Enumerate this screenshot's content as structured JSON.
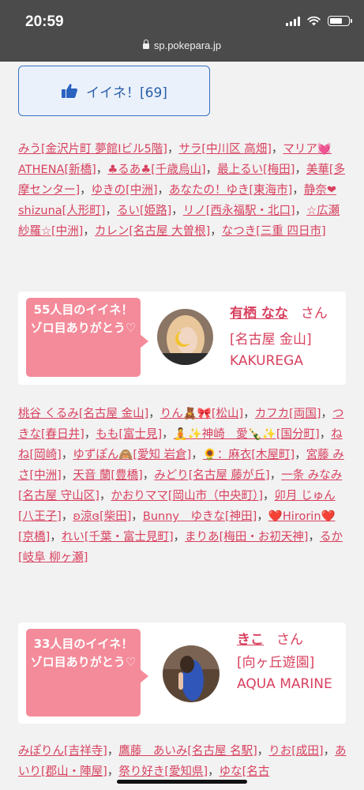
{
  "status_bar": {
    "time": "20:59"
  },
  "browser": {
    "url": "sp.pokepara.jp"
  },
  "like_button": {
    "label": "イイネ！[69]",
    "icon": "thumbs-up-icon"
  },
  "list1": [
    {
      "name": "みう[金沢片町 夢館Ⅰビル5階]"
    },
    {
      "name": "サラ[中川区 高畑]"
    },
    {
      "name": "マリア💓ATHENA[新橋]"
    },
    {
      "name": "♣るあ♣[千歳烏山]"
    },
    {
      "name": "最上るい[梅田]"
    },
    {
      "name": "美華[多摩センター]"
    },
    {
      "name": "ゆきの[中洲]"
    },
    {
      "name": "あなたの！ゆき[東海市]"
    },
    {
      "name": "静奈❤shizuna[人形町]"
    },
    {
      "name": "るい[姫路]"
    },
    {
      "name": "リノ[西永福駅・北口]"
    },
    {
      "name": "☆広瀬 紗羅☆[中洲]"
    },
    {
      "name": "カレン[名古屋 大曽根]"
    },
    {
      "name": "なつき[三重 四日市]"
    }
  ],
  "card1": {
    "bubble_line1": "55人目のイイネ！",
    "bubble_line2": "ゾロ目ありがとう♡",
    "girl_name": "有栖 なな",
    "honorific": "さん",
    "shop": "[名古屋 金山] KAKUREGA"
  },
  "list2": [
    {
      "name": "桃谷 くるみ[名古屋 金山]"
    },
    {
      "name": "りん🧸🎀[松山]"
    },
    {
      "name": "カフカ[両国]"
    },
    {
      "name": "つきな[春日井]"
    },
    {
      "name": "もも[富士見]"
    },
    {
      "name": "🧘✨神崎　愛🍾✨[国分町]"
    },
    {
      "name": "ねね[岡崎]"
    },
    {
      "name": "ゆずぽん🙈[愛知 岩倉]"
    },
    {
      "name": "🌻：麻衣[木屋町]"
    },
    {
      "name": "宮藤 みさ[中洲]"
    },
    {
      "name": "天音 蘭[豊橋]"
    },
    {
      "name": "みどり[名古屋 藤が丘]"
    },
    {
      "name": "一条 みなみ[名古屋 守山区]"
    },
    {
      "name": "かおりママ[岡山市（中央町）]"
    },
    {
      "name": "卯月 じゅん[八王子]"
    },
    {
      "name": "ʚ涼ɞ[柴田]"
    },
    {
      "name": "Bunny　ゆきな[神田]"
    },
    {
      "name": "❤️Hirorin❤️[京橋]"
    },
    {
      "name": "れい[千葉・富士見町]"
    },
    {
      "name": "まりあ[梅田・お初天神]"
    },
    {
      "name": "るか[岐阜 柳ヶ瀬]"
    }
  ],
  "card2": {
    "bubble_line1": "33人目のイイネ！",
    "bubble_line2": "ゾロ目ありがとう♡",
    "girl_name": "きこ",
    "honorific": "さん",
    "shop": "[向ヶ丘遊園] AQUA MARINE"
  },
  "list3": [
    {
      "name": "みぽりん[吉祥寺]"
    },
    {
      "name": "鷹藤　あいみ[名古屋 名駅]"
    },
    {
      "name": "りお[成田]"
    },
    {
      "name": "あいり[郡山・陣屋]"
    },
    {
      "name": "祭り好き[愛知県]"
    },
    {
      "name": "ゆな[名古"
    }
  ],
  "colors": {
    "link": "#d8415f",
    "bubble": "#f48b9a",
    "like_border": "#3a72c4",
    "chrome": "#4b4b4b"
  }
}
